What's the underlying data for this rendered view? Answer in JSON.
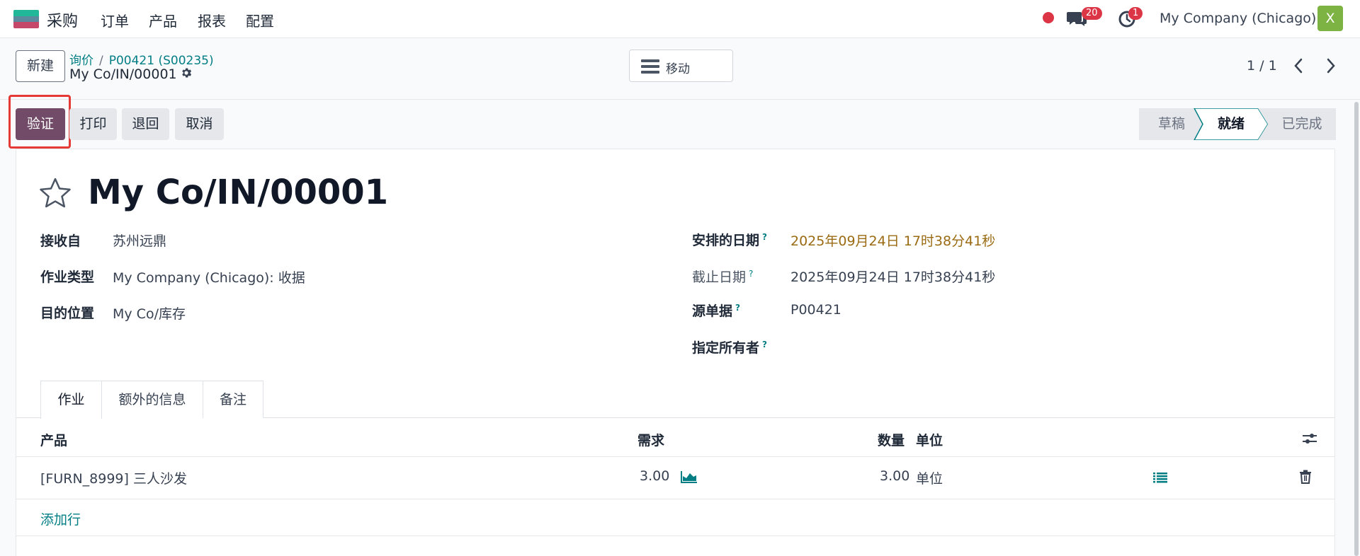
{
  "navbar": {
    "app_name": "采购",
    "menu": [
      "订单",
      "产品",
      "报表",
      "配置"
    ],
    "messages_count": "20",
    "activities_count": "1",
    "company": "My Company (Chicago)",
    "avatar_letter": "X"
  },
  "control_panel": {
    "new_button": "新建",
    "breadcrumb": [
      "询价",
      "P00421 (S00235)"
    ],
    "breadcrumb_separator": "/",
    "record_name": "My Co/IN/00001",
    "move_button": "移动",
    "pager": "1 / 1"
  },
  "actions": {
    "validate": "验证",
    "print": "打印",
    "return": "退回",
    "cancel": "取消"
  },
  "status_bar": {
    "steps": [
      "草稿",
      "就绪",
      "已完成"
    ],
    "current": "就绪"
  },
  "form": {
    "title": "My Co/IN/00001",
    "left_fields": [
      {
        "label": "接收自",
        "value": "苏州远鼎"
      },
      {
        "label": "作业类型",
        "value": "My Company (Chicago): 收据"
      },
      {
        "label": "目的位置",
        "value": "My Co/库存"
      }
    ],
    "right_fields": [
      {
        "label": "安排的日期",
        "value": "2025年09月24日 17时38分41秒"
      },
      {
        "label": "截止日期",
        "value": "2025年09月24日 17时38分41秒"
      },
      {
        "label": "源单据",
        "value": "P00421"
      },
      {
        "label": "指定所有者",
        "value": ""
      }
    ],
    "help_mark": "?"
  },
  "tabs": [
    "作业",
    "额外的信息",
    "备注"
  ],
  "operations_table": {
    "headers": {
      "product": "产品",
      "demand": "需求",
      "quantity": "数量",
      "uom": "单位"
    },
    "rows": [
      {
        "product": "[FURN_8999] 三人沙发",
        "demand": "3.00",
        "quantity": "3.00",
        "uom": "单位"
      }
    ],
    "add_line": "添加行"
  },
  "colors": {
    "primary": "#714b67",
    "link": "#017e84",
    "highlight": "#e53935",
    "badge": "#dc3545",
    "avatar": "#7cb342"
  }
}
